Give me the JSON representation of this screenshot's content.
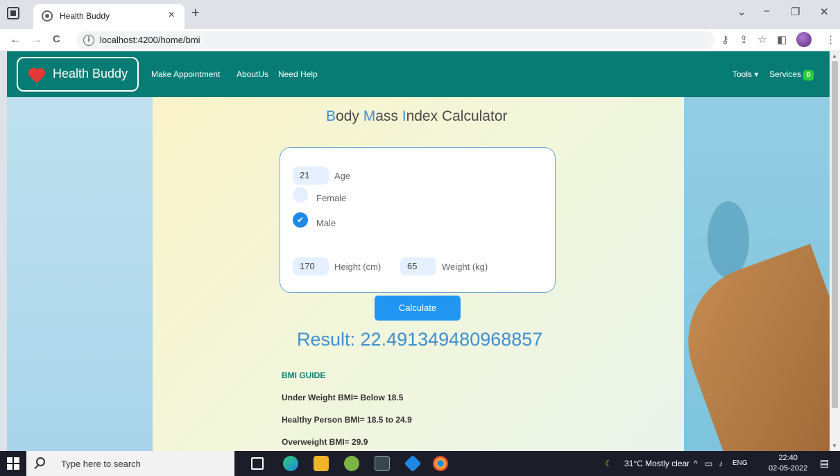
{
  "browser": {
    "tab_title": "Health Buddy",
    "tab_close": "×",
    "new_tab": "+",
    "url": "localhost:4200/home/bmi",
    "controls": {
      "dropdown": "⌄",
      "minimize": "−",
      "restore": "❐",
      "close": "✕"
    },
    "nav": {
      "back": "←",
      "forward": "→",
      "reload": "C"
    }
  },
  "navbar": {
    "brand": "Health Buddy",
    "links": [
      "Make Appointment",
      "AboutUs",
      "Need Help"
    ],
    "tools": "Tools ▾",
    "services": "Services",
    "services_badge": "0",
    "bg_color": "#067c74"
  },
  "calculator": {
    "title_parts": [
      "B",
      "ody ",
      "M",
      "ass ",
      "I",
      "ndex Calculator"
    ],
    "age_value": "21",
    "age_label": "Age",
    "female_label": "Female",
    "male_label": "Male",
    "selected_gender": "Male",
    "height_value": "170",
    "height_label": "Height (cm)",
    "weight_value": "65",
    "weight_label": "Weight (kg)",
    "calculate_label": "Calculate",
    "result": "Result: 22.491349480968857"
  },
  "guide": {
    "title": "BMI GUIDE",
    "lines": [
      "Under Weight BMI= Below 18.5",
      "Healthy Person BMI= 18.5 to 24.9",
      "Overweight BMI= 29.9"
    ]
  },
  "taskbar": {
    "search_placeholder": "Type here to search",
    "weather": "31°C  Mostly clear",
    "lang": "ENG",
    "time": "22:40",
    "date": "02-05-2022"
  },
  "colors": {
    "accent": "#3f8fd2",
    "button": "#2196f3",
    "badge": "#2ecc40"
  }
}
